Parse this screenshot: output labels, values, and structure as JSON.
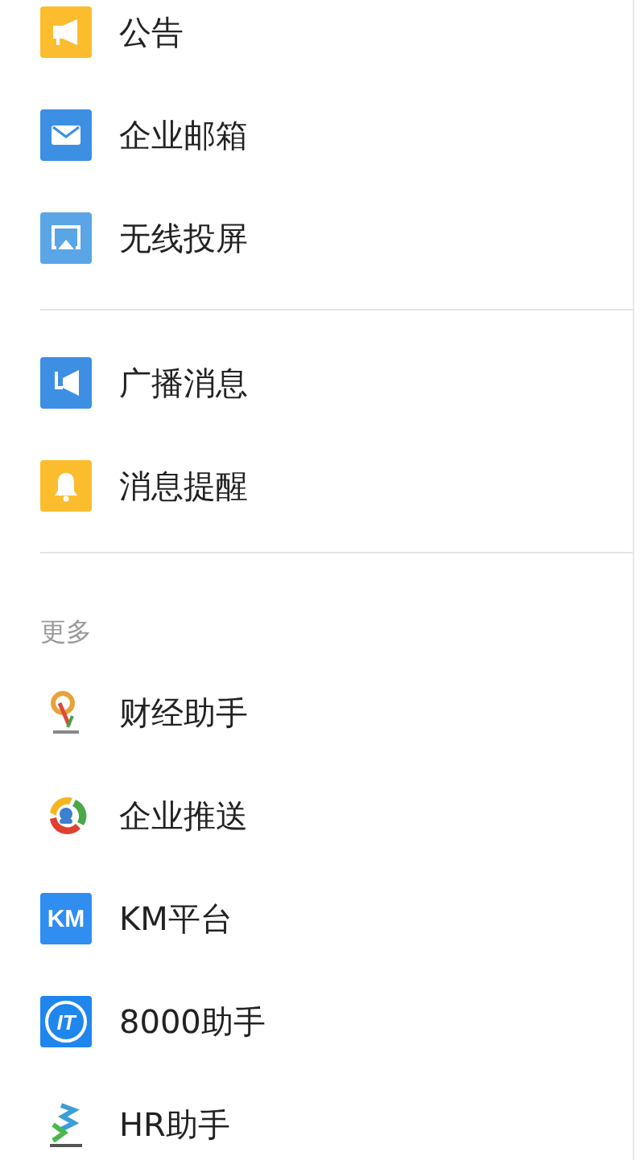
{
  "sections": [
    {
      "items": [
        {
          "label": "公告",
          "kind": "announcement"
        },
        {
          "label": "企业邮箱",
          "kind": "mail"
        },
        {
          "label": "无线投屏",
          "kind": "cast"
        }
      ]
    },
    {
      "items": [
        {
          "label": "广播消息",
          "kind": "broadcast"
        },
        {
          "label": "消息提醒",
          "kind": "bell"
        }
      ]
    },
    {
      "title": "更多",
      "items": [
        {
          "label": "财经助手",
          "kind": "finance"
        },
        {
          "label": "企业推送",
          "kind": "ring"
        },
        {
          "label": "KM平台",
          "kind": "text-blue",
          "icon_text": "KM"
        },
        {
          "label": "8000助手",
          "kind": "it",
          "icon_text": "IT"
        },
        {
          "label": "HR助手",
          "kind": "hr"
        }
      ]
    }
  ]
}
